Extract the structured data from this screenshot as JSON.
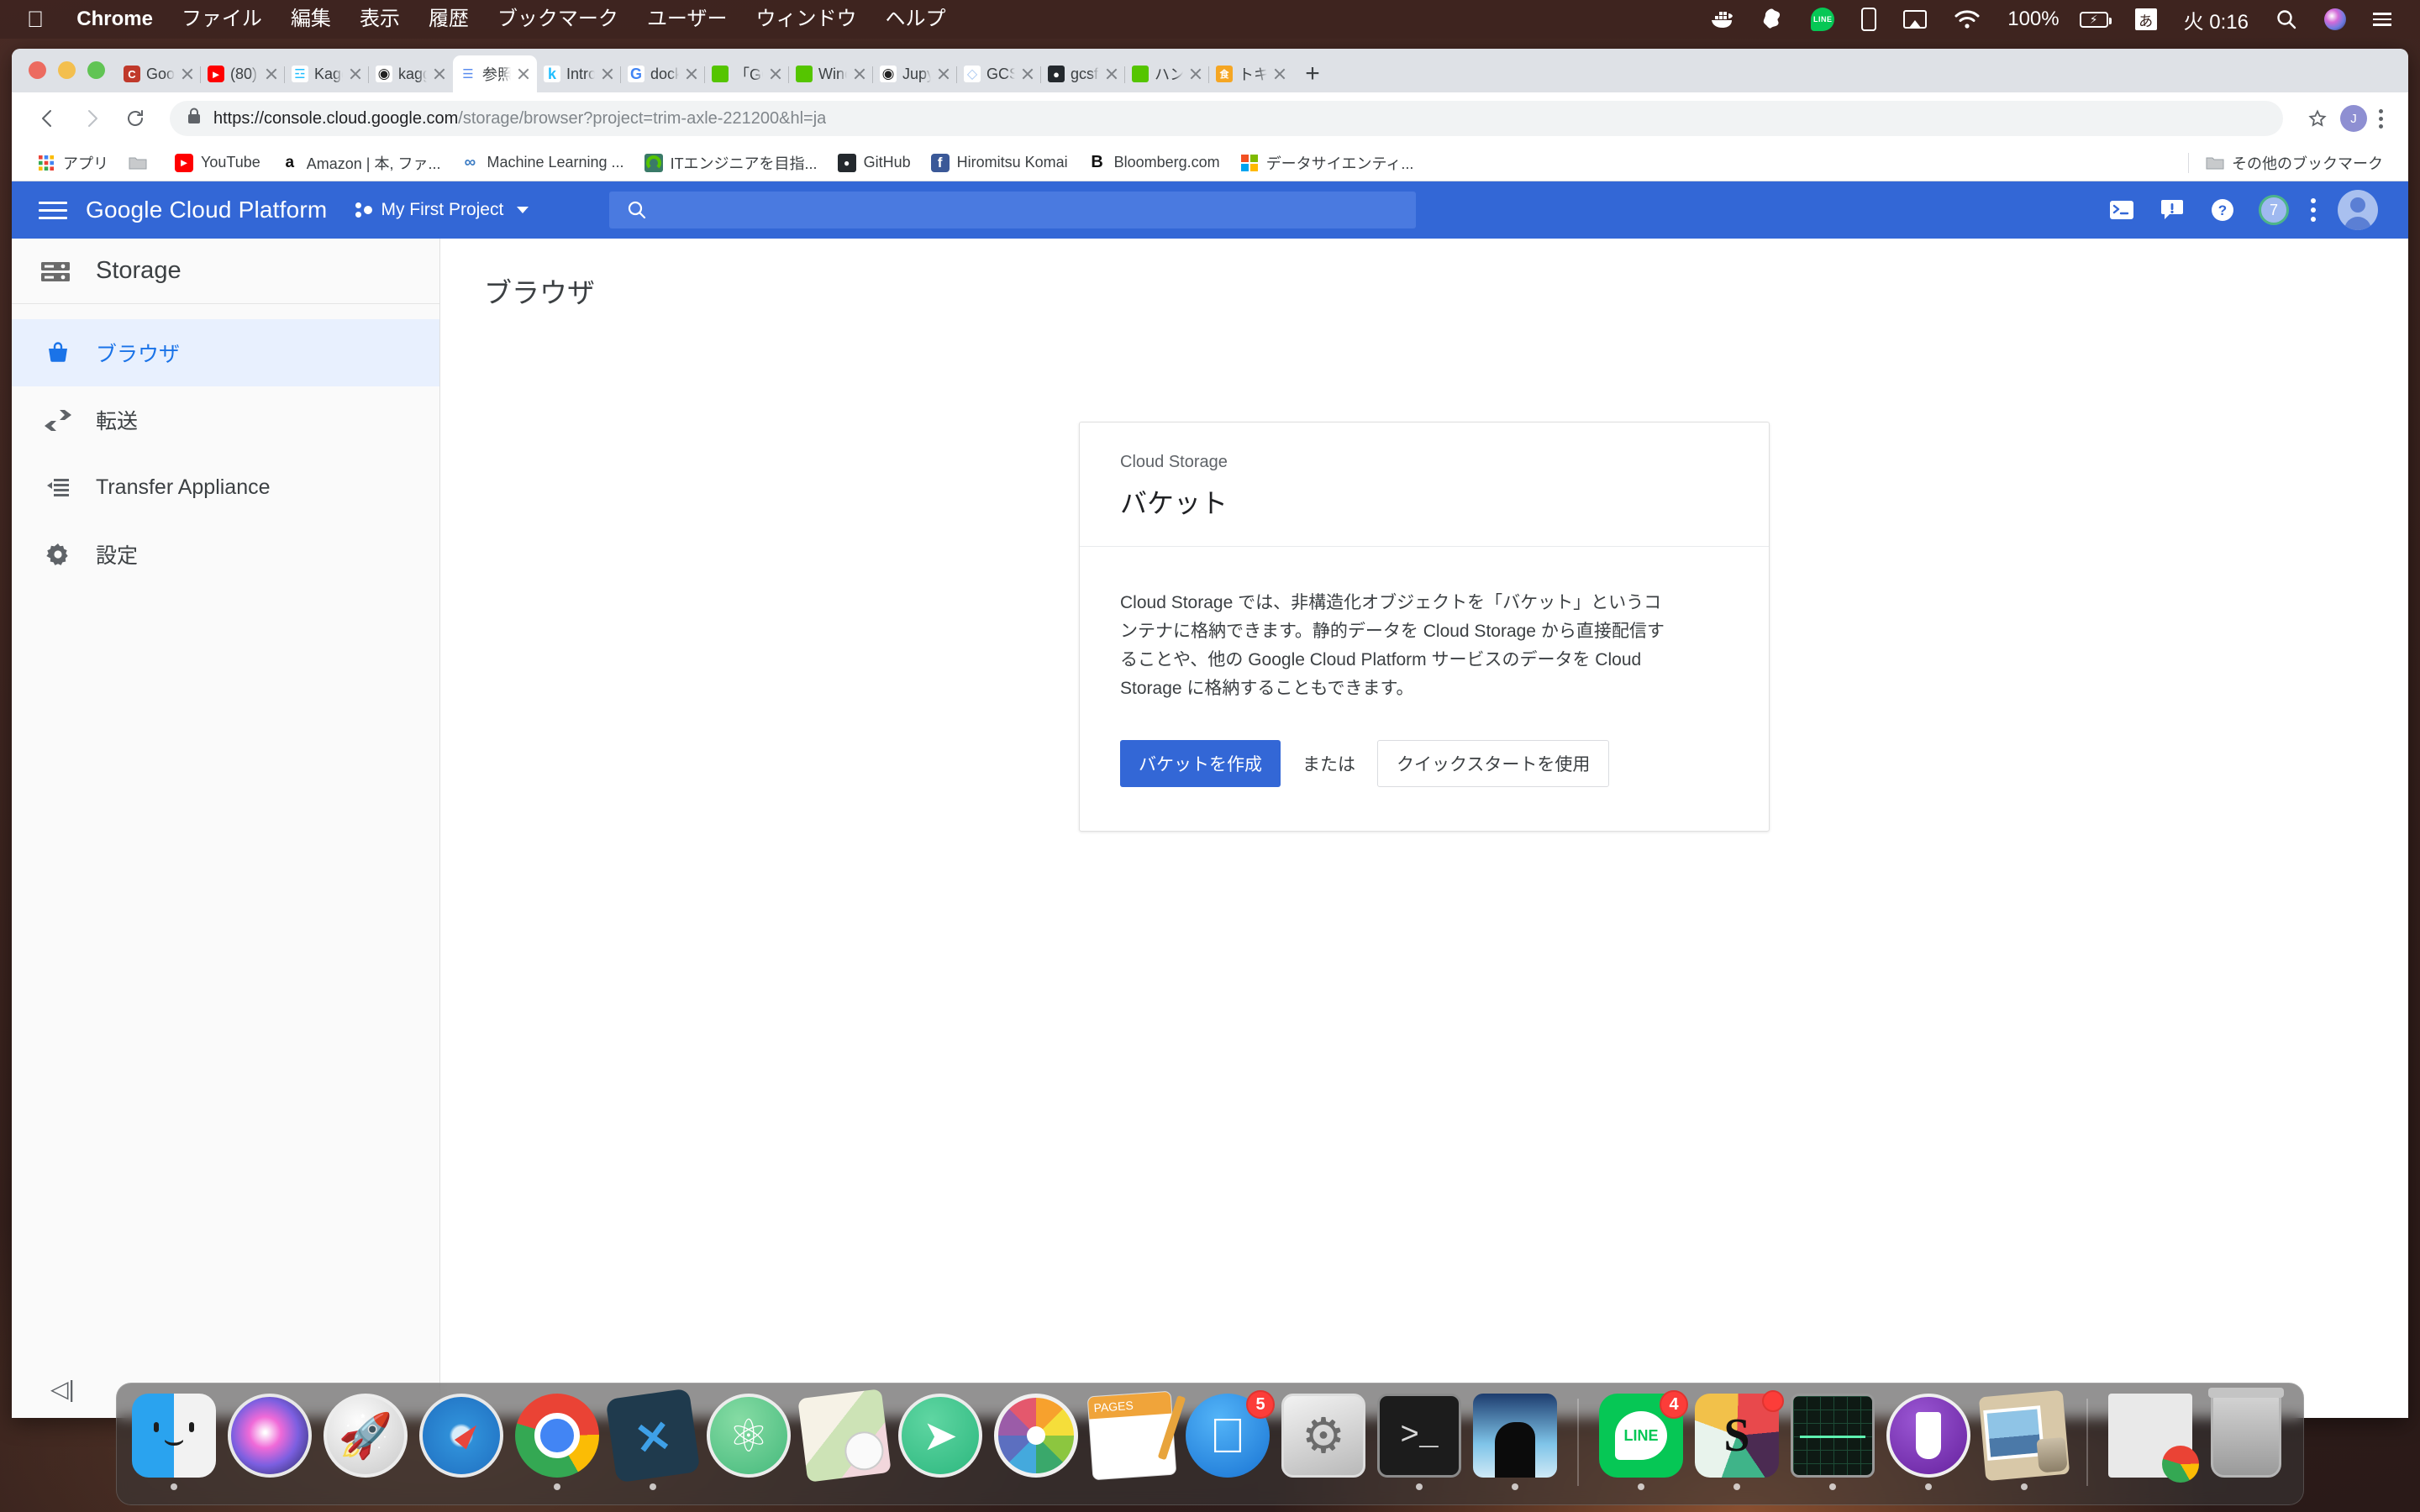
{
  "menubar": {
    "apple": "",
    "items": [
      "Chrome",
      "ファイル",
      "編集",
      "表示",
      "履歴",
      "ブックマーク",
      "ユーザー",
      "ウィンドウ",
      "ヘルプ"
    ],
    "status": {
      "docker": "docker-icon",
      "alfred": "alfred-icon",
      "line": "LINE",
      "phone": "phone-icon",
      "airplay": "airplay-icon",
      "wifi": "wifi-icon",
      "battery_percent": "100%",
      "battery": "battery-charging-icon",
      "input_source": "あ",
      "clock": "火 0:16",
      "spotlight": "search-icon",
      "siri": "siri-icon",
      "control_center": "list-icon"
    }
  },
  "chrome": {
    "tabs": [
      {
        "title": "Goog",
        "favicon": "candy-red",
        "active": false
      },
      {
        "title": "(80)",
        "favicon": "youtube",
        "active": false
      },
      {
        "title": "Kagg",
        "favicon": "kaggle-white",
        "active": false
      },
      {
        "title": "kagg",
        "favicon": "jupyter-pen",
        "active": false
      },
      {
        "title": "参照",
        "favicon": "gcp-storage",
        "active": true
      },
      {
        "title": "Intro",
        "favicon": "kaggle-k",
        "active": false
      },
      {
        "title": "dock",
        "favicon": "google-g",
        "active": false
      },
      {
        "title": "「GC",
        "favicon": "qiita",
        "active": false
      },
      {
        "title": "Wind",
        "favicon": "qiita",
        "active": false
      },
      {
        "title": "Jupy",
        "favicon": "jupyter-pen",
        "active": false
      },
      {
        "title": "GCSA",
        "favicon": "gcs-blue",
        "active": false
      },
      {
        "title": "gcsfu",
        "favicon": "github",
        "active": false
      },
      {
        "title": "ハンз",
        "favicon": "qiita",
        "active": false
      },
      {
        "title": "トキナ",
        "favicon": "tabelog",
        "active": false
      }
    ],
    "new_tab_label": "+",
    "toolbar": {
      "back": "back-arrow-icon",
      "forward": "forward-arrow-icon",
      "reload": "reload-icon",
      "lock": "lock-icon",
      "url_bold": "https://console.cloud.google.com",
      "url_rest": "/storage/browser?project=trim-axle-221200&hl=ja",
      "url_full": "https://console.cloud.google.com/storage/browser?project=trim-axle-221200&hl=ja",
      "star": "star-icon",
      "profile_initial": "J",
      "menu": "kebab-menu-icon"
    },
    "bookmarks": [
      {
        "label": "アプリ",
        "icon": "google-apps-grid"
      },
      {
        "label": "",
        "icon": "folder"
      },
      {
        "label": "YouTube",
        "icon": "youtube"
      },
      {
        "label": "Amazon | 本, ファ...",
        "icon": "amazon"
      },
      {
        "label": "Machine Learning ...",
        "icon": "coursera"
      },
      {
        "label": "ITエンジニアを目指...",
        "icon": "qiita"
      },
      {
        "label": "GitHub",
        "icon": "github"
      },
      {
        "label": "Hiromitsu Komai",
        "icon": "facebook"
      },
      {
        "label": "Bloomberg.com",
        "icon": "bloomberg"
      },
      {
        "label": "データサイエンティ...",
        "icon": "microsoft"
      }
    ],
    "other_bookmarks": {
      "label": "その他のブックマーク",
      "icon": "folder"
    }
  },
  "gcp": {
    "header": {
      "menu": "hamburger-menu-icon",
      "logo": "Google Cloud Platform",
      "project": "My First Project",
      "project_caret": "chevron-down-icon",
      "search_placeholder": "",
      "search_icon": "search-icon",
      "cloud_shell": "cloud-shell-icon",
      "notifications": "notifications-icon",
      "help": "help-icon",
      "badge_count": "7",
      "more": "more-vert-icon",
      "account": "account-avatar"
    },
    "sidebar": {
      "service": "Storage",
      "service_icon": "storage-icon",
      "items": [
        {
          "label": "ブラウザ",
          "icon": "bucket-icon",
          "active": true
        },
        {
          "label": "転送",
          "icon": "transfer-icon",
          "active": false
        },
        {
          "label": "Transfer Appliance",
          "icon": "appliance-icon",
          "active": false
        },
        {
          "label": "設定",
          "icon": "gear-icon",
          "active": false
        }
      ],
      "collapse_label": "◁|"
    },
    "content": {
      "page_title": "ブラウザ",
      "card": {
        "kicker": "Cloud Storage",
        "title": "バケット",
        "description": "Cloud Storage では、非構造化オブジェクトを「バケット」というコンテナに格納できます。静的データを Cloud Storage から直接配信することや、他の Google Cloud Platform サービスのデータを Cloud Storage に格納することもできます。",
        "primary_button": "バケットを作成",
        "or_label": "または",
        "secondary_button": "クイックスタートを使用"
      }
    }
  },
  "dock": {
    "items": [
      {
        "name": "Finder",
        "art": "i-finder",
        "running": true,
        "badge": ""
      },
      {
        "name": "Siri",
        "art": "i-siri",
        "running": false,
        "badge": ""
      },
      {
        "name": "Launchpad",
        "art": "i-launchpad",
        "running": false,
        "badge": ""
      },
      {
        "name": "Safari",
        "art": "i-safari",
        "running": false,
        "badge": ""
      },
      {
        "name": "Google Chrome",
        "art": "i-chrome",
        "running": true,
        "badge": ""
      },
      {
        "name": "Visual Studio Code",
        "art": "i-vscode",
        "running": true,
        "badge": ""
      },
      {
        "name": "Atom",
        "art": "i-atom",
        "running": false,
        "badge": ""
      },
      {
        "name": "Maps",
        "art": "i-maps",
        "running": false,
        "badge": ""
      },
      {
        "name": "Telegram",
        "art": "i-telegram",
        "running": false,
        "badge": ""
      },
      {
        "name": "Photos",
        "art": "i-photos",
        "running": false,
        "badge": ""
      },
      {
        "name": "Pages",
        "art": "i-pages",
        "running": false,
        "badge": ""
      },
      {
        "name": "App Store",
        "art": "i-appstore",
        "running": false,
        "badge": "5"
      },
      {
        "name": "System Preferences",
        "art": "i-prefs",
        "running": false,
        "badge": ""
      },
      {
        "name": "Terminal",
        "art": "i-terminal",
        "running": true,
        "badge": ""
      },
      {
        "name": "Kindle",
        "art": "i-kindle",
        "running": true,
        "badge": ""
      },
      {
        "name": "LINE",
        "art": "i-linedock",
        "running": true,
        "badge": "4"
      },
      {
        "name": "Slack",
        "art": "i-slack",
        "running": true,
        "badge": "•"
      },
      {
        "name": "Activity Monitor",
        "art": "i-activity",
        "running": true,
        "badge": ""
      },
      {
        "name": "Evernote",
        "art": "i-evernote",
        "running": true,
        "badge": ""
      },
      {
        "name": "Preview",
        "art": "i-preview",
        "running": true,
        "badge": ""
      },
      {
        "name": "Minimized Window",
        "art": "i-docwin",
        "running": false,
        "badge": ""
      },
      {
        "name": "Trash",
        "art": "i-trash",
        "running": false,
        "badge": ""
      }
    ]
  }
}
